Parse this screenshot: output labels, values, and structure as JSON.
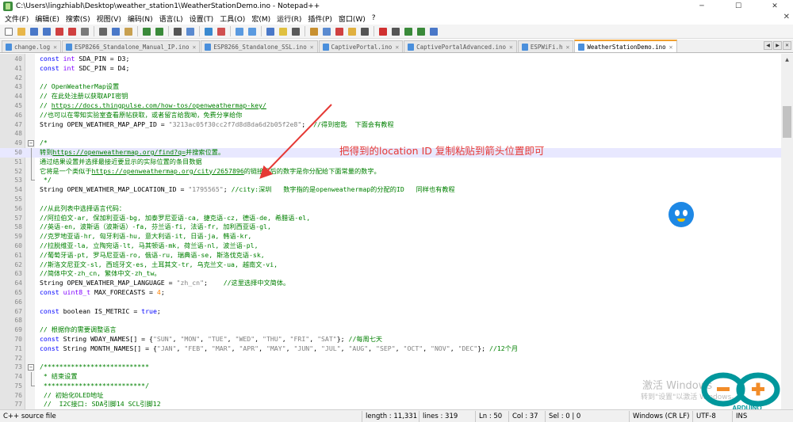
{
  "window": {
    "title": "C:\\Users\\lingzhiabl\\Desktop\\weather_station1\\WeatherStationDemo.ino - Notepad++",
    "minimize": "─",
    "maximize": "☐",
    "close": "✕"
  },
  "menu": {
    "items": [
      "文件(F)",
      "编辑(E)",
      "搜索(S)",
      "视图(V)",
      "编码(N)",
      "语言(L)",
      "设置(T)",
      "工具(O)",
      "宏(M)",
      "运行(R)",
      "插件(P)",
      "窗口(W)",
      "?"
    ],
    "close": "✕"
  },
  "toolbar": {
    "buttons": [
      {
        "name": "new-file-icon",
        "color": "#ffffff",
        "border": "#777"
      },
      {
        "name": "open-file-icon",
        "color": "#e8b64a"
      },
      {
        "name": "save-icon",
        "color": "#4a78c8"
      },
      {
        "name": "save-all-icon",
        "color": "#4a78c8"
      },
      {
        "name": "close-icon",
        "color": "#d04040"
      },
      {
        "name": "close-all-icon",
        "color": "#d04040"
      },
      {
        "name": "print-icon",
        "color": "#7a7a7a"
      },
      "sep",
      {
        "name": "cut-icon",
        "color": "#666"
      },
      {
        "name": "copy-icon",
        "color": "#4a78c8"
      },
      {
        "name": "paste-icon",
        "color": "#c8a050"
      },
      "sep",
      {
        "name": "undo-icon",
        "color": "#3a8a3a"
      },
      {
        "name": "redo-icon",
        "color": "#3a8a3a"
      },
      "sep",
      {
        "name": "find-icon",
        "color": "#555"
      },
      {
        "name": "replace-icon",
        "color": "#5a8ad0"
      },
      "sep",
      {
        "name": "zoom-in-icon",
        "color": "#3a8ad0"
      },
      {
        "name": "zoom-out-icon",
        "color": "#d05050"
      },
      "sep",
      {
        "name": "sync-vertical-icon",
        "color": "#5a9ae0"
      },
      {
        "name": "sync-horizontal-icon",
        "color": "#5a9ae0"
      },
      "sep",
      {
        "name": "word-wrap-icon",
        "color": "#4a78c8"
      },
      {
        "name": "show-all-chars-icon",
        "color": "#e0c040"
      },
      {
        "name": "indent-guide-icon",
        "color": "#5a5a5a"
      },
      "sep",
      {
        "name": "user-lang-icon",
        "color": "#c89030"
      },
      {
        "name": "doc-map-icon",
        "color": "#5a8ad0"
      },
      {
        "name": "function-list-icon",
        "color": "#d04040"
      },
      {
        "name": "folder-workspace-icon",
        "color": "#e0b040"
      },
      {
        "name": "monitoring-icon",
        "color": "#555"
      },
      "sep",
      {
        "name": "record-macro-icon",
        "color": "#d03030"
      },
      {
        "name": "stop-record-icon",
        "color": "#555"
      },
      {
        "name": "play-macro-icon",
        "color": "#3a8a3a"
      },
      {
        "name": "play-multiple-icon",
        "color": "#3a8a3a"
      },
      {
        "name": "save-macro-icon",
        "color": "#4a78c8"
      }
    ]
  },
  "tabs": [
    {
      "label": "change.log",
      "active": false
    },
    {
      "label": "ESP8266_Standalone_Manual_IP.ino",
      "active": false
    },
    {
      "label": "ESP8266_Standalone_SSL.ino",
      "active": false
    },
    {
      "label": "CaptivePortal.ino",
      "active": false
    },
    {
      "label": "CaptivePortalAdvanced.ino",
      "active": false
    },
    {
      "label": "ESPWiFi.h",
      "active": false
    },
    {
      "label": "WeatherStationDemo.ino",
      "active": true
    }
  ],
  "annotation": "把得到的location ID 复制粘贴到箭头位置即可",
  "lines": [
    {
      "n": "40",
      "html": "<span class='k'>const</span> <span class='t'>int</span> SDA_PIN = D3;"
    },
    {
      "n": "41",
      "html": "<span class='k'>const</span> <span class='t'>int</span> SDC_PIN = D4;"
    },
    {
      "n": "42",
      "html": ""
    },
    {
      "n": "43",
      "html": "<span class='c'>// OpenWeatherMap设置</span>"
    },
    {
      "n": "44",
      "html": "<span class='c'>// 在此处注册以获取API密钥</span>"
    },
    {
      "n": "45",
      "html": "<span class='c'>// </span><span class='u'>https://docs.thingpulse.com/how-tos/openweathermap-key/</span>"
    },
    {
      "n": "46",
      "html": "<span class='c'>//也可以在零知实验室查看原帖获取，或者留言给我呦，免费分享给你</span>"
    },
    {
      "n": "47",
      "html": "String OPEN_WEATHER_MAP_APP_ID = <span class='s'>\"3213ac05f30cc2f7d8d8da6d2b05f2e8\"</span>;  <span class='c'>//得到密匙  下面会有教程</span>"
    },
    {
      "n": "48",
      "html": ""
    },
    {
      "n": "49",
      "fold": "box",
      "html": "<span class='bc'>/*</span>"
    },
    {
      "n": "50",
      "fold": "vline",
      "hl": true,
      "html": "<span class='bc'>转到</span><span class='u'>https://openweathermap.org/find?q=</span><span class='bc'>并搜索位置。</span>"
    },
    {
      "n": "51",
      "fold": "vline",
      "html": "<span class='bc'>通过结果设置并选择最接近要显示的实际位置的条目数据</span>"
    },
    {
      "n": "52",
      "fold": "vline",
      "html": "<span class='bc'>它将是一个类似于</span><span class='u'>https://openweathermap.org/city/2657896</span><span class='bc'>的链接最后的数字是你分配给下面常量的数字。</span>"
    },
    {
      "n": "53",
      "fold": "end",
      "html": "<span class='bc'> */</span>"
    },
    {
      "n": "54",
      "html": "String OPEN_WEATHER_MAP_LOCATION_ID = <span class='s'>\"1795565\"</span>; <span class='c'>//city:深圳   数字指的是openweathermap的分配的ID   同样也有教程</span>"
    },
    {
      "n": "55",
      "html": ""
    },
    {
      "n": "56",
      "html": "<span class='c'>//从此列表中选择语言代码：</span>"
    },
    {
      "n": "57",
      "html": "<span class='c'>//阿拉伯文-ar, 保加利亚语-bg, 加泰罗尼亚语-ca, 捷克语-cz, 德语-de, 希腊语-el,</span>"
    },
    {
      "n": "58",
      "html": "<span class='c'>//英语-en, 波斯语（波斯语）-fa, 芬兰语-fi, 法语-fr, 加利西亚语-gl,</span>"
    },
    {
      "n": "59",
      "html": "<span class='c'>//克罗地亚语-hr, 匈牙利语-hu, 意大利语-it, 日语-ja, 韩语-kr,</span>"
    },
    {
      "n": "60",
      "html": "<span class='c'>//拉脱维亚-la, 立陶宛语-lt, 马其顿语-mk, 荷兰语-nl, 波兰语-pl,</span>"
    },
    {
      "n": "61",
      "html": "<span class='c'>//葡萄牙语-pt, 罗马尼亚语-ro, 俄语-ru, 瑞典语-se, 斯洛伐克语-sk,</span>"
    },
    {
      "n": "62",
      "html": "<span class='c'>//斯洛文尼亚文-sl, 西班牙文-es, 土耳其文-tr, 乌克兰文-ua, 越南文-vi,</span>"
    },
    {
      "n": "63",
      "html": "<span class='c'>//简体中文-zh_cn, 繁体中文-zh_tw。</span>"
    },
    {
      "n": "64",
      "html": "String OPEN_WEATHER_MAP_LANGUAGE = <span class='s'>\"zh_cn\"</span>;    <span class='c'>//这里选择中文简体。</span>"
    },
    {
      "n": "65",
      "html": "<span class='k'>const</span> <span class='t'>uint8_t</span> MAX_FORECASTS = <span class='n'>4</span>;"
    },
    {
      "n": "66",
      "html": ""
    },
    {
      "n": "67",
      "html": "<span class='k'>const</span> boolean IS_METRIC = <span class='k'>true</span>;"
    },
    {
      "n": "68",
      "html": ""
    },
    {
      "n": "69",
      "html": "<span class='c'>// 根据你的需要调整语言</span>"
    },
    {
      "n": "70",
      "html": "<span class='k'>const</span> String WDAY_NAMES[] = {<span class='s'>\"SUN\"</span>, <span class='s'>\"MON\"</span>, <span class='s'>\"TUE\"</span>, <span class='s'>\"WED\"</span>, <span class='s'>\"THU\"</span>, <span class='s'>\"FRI\"</span>, <span class='s'>\"SAT\"</span>}; <span class='c'>//每周七天</span>"
    },
    {
      "n": "71",
      "html": "<span class='k'>const</span> String MONTH_NAMES[] = {<span class='s'>\"JAN\"</span>, <span class='s'>\"FEB\"</span>, <span class='s'>\"MAR\"</span>, <span class='s'>\"APR\"</span>, <span class='s'>\"MAY\"</span>, <span class='s'>\"JUN\"</span>, <span class='s'>\"JUL\"</span>, <span class='s'>\"AUG\"</span>, <span class='s'>\"SEP\"</span>, <span class='s'>\"OCT\"</span>, <span class='s'>\"NOV\"</span>, <span class='s'>\"DEC\"</span>}; <span class='c'>//12个月</span>"
    },
    {
      "n": "72",
      "html": ""
    },
    {
      "n": "73",
      "fold": "box",
      "html": "<span class='bc'>/***************************</span>"
    },
    {
      "n": "74",
      "fold": "vline",
      "html": "<span class='bc'> * 结束设置</span>"
    },
    {
      "n": "75",
      "fold": "end",
      "html": "<span class='bc'> **************************/</span>"
    },
    {
      "n": "76",
      "html": " <span class='c'>// 初始化OLED地址</span>"
    },
    {
      "n": "77",
      "html": " <span class='c'>//  I2C接口: SDA引脚14 SCL引脚12</span>"
    }
  ],
  "status": {
    "lang": "C++ source file",
    "length": "length : 11,331",
    "lines": "lines : 319",
    "ln": "Ln : 50",
    "col": "Col : 37",
    "sel": "Sel : 0 | 0",
    "eol": "Windows (CR LF)",
    "enc": "UTF-8",
    "ins": "INS"
  },
  "watermark": {
    "line1": "激活 Windows",
    "line2": "转到\"设置\"以激活 Windows。"
  }
}
